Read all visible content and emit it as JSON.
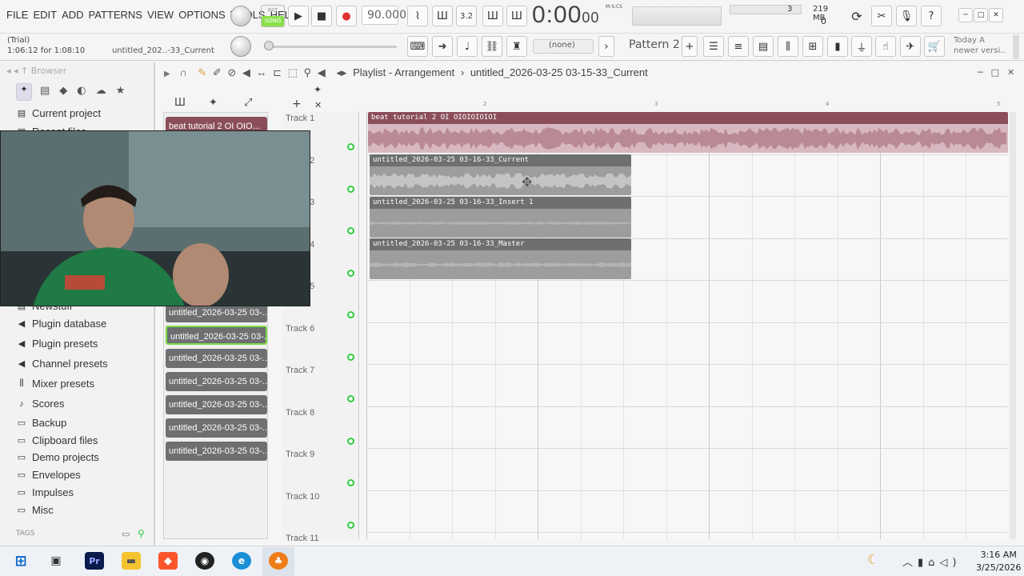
{
  "menu": [
    "FILE",
    "EDIT",
    "ADD",
    "PATTERNS",
    "VIEW",
    "OPTIONS",
    "TOOLS",
    "HELP"
  ],
  "transport": {
    "pat": "PAT",
    "song": "SONG",
    "bpm": "90.000",
    "time_main": "0:00",
    "time_sub": "00",
    "time_unit": "M:S:CS"
  },
  "resources": {
    "cpu_count": "3",
    "memory": "219 MB",
    "poly": "0"
  },
  "status": {
    "trial": "(Trial)",
    "elapsed": "1:06:12 for 1:08:10",
    "project": "untitled_202..-33_Current"
  },
  "pattern": {
    "none": "(none)",
    "current": "Pattern 2",
    "add": "+"
  },
  "news": {
    "line1": "Today   A",
    "line2": "newer versi.."
  },
  "browser": {
    "title": "Browser",
    "items": [
      {
        "label": "Current project",
        "icon": "folder-icon"
      },
      {
        "label": "Recent files",
        "icon": "folder-icon"
      },
      {
        "label": "Newstuff",
        "icon": "folder-icon"
      },
      {
        "label": "Plugin database",
        "icon": "plug-icon"
      },
      {
        "label": "Plugin presets",
        "icon": "plug-icon"
      },
      {
        "label": "Channel presets",
        "icon": "plug-icon"
      },
      {
        "label": "Mixer presets",
        "icon": "mixer-icon"
      },
      {
        "label": "Scores",
        "icon": "note-icon"
      },
      {
        "label": "Backup",
        "icon": "folder-icon"
      },
      {
        "label": "Clipboard files",
        "icon": "folder-icon"
      },
      {
        "label": "Demo projects",
        "icon": "folder-icon"
      },
      {
        "label": "Envelopes",
        "icon": "folder-icon"
      },
      {
        "label": "Impulses",
        "icon": "folder-icon"
      },
      {
        "label": "Misc",
        "icon": "folder-icon"
      }
    ],
    "tags": "TAGS"
  },
  "picker": {
    "clips": [
      "beat tutorial 2 OI OIO...",
      "untitled_2026-03-25 03-...",
      "untitled_2026-03-25 03-...",
      "untitled_2026-03-25 03-...",
      "untitled_2026-03-25 03-...",
      "untitled_2026-03-25 03-...",
      "untitled_2026-03-25 03-...",
      "untitled_2026-03-25 03-..."
    ]
  },
  "playlist": {
    "title": "Playlist - Arrangement",
    "sep": "›",
    "project": "untitled_2026-03-25 03-15-33_Current",
    "tracks": [
      "Track 1",
      "Track 2",
      "Track 3",
      "Track 4",
      "Track 5",
      "Track 6",
      "Track 7",
      "Track 8",
      "Track 9",
      "Track 10",
      "Track 11"
    ],
    "bar_numbers": [
      "2",
      "3",
      "4",
      "5"
    ],
    "regions": [
      {
        "label": "beat tutorial 2 OI OIOIOIOIOI",
        "color": "#8a4e5a",
        "wave": "#c89aa4"
      },
      {
        "label": "untitled_2026-03-25 03-16-33_Current",
        "color": "#6e6f70",
        "wave": "#b8b8b8"
      },
      {
        "label": "untitled_2026-03-25 03-16-33_Insert 1",
        "color": "#6e6f70",
        "wave": "#b8b8b8"
      },
      {
        "label": "untitled_2026-03-25 03-16-33_Master",
        "color": "#6e6f70",
        "wave": "#b8b8b8"
      }
    ]
  },
  "taskbar": {
    "time": "3:16 AM",
    "date": "3/25/2026",
    "premiere": "Pr"
  }
}
